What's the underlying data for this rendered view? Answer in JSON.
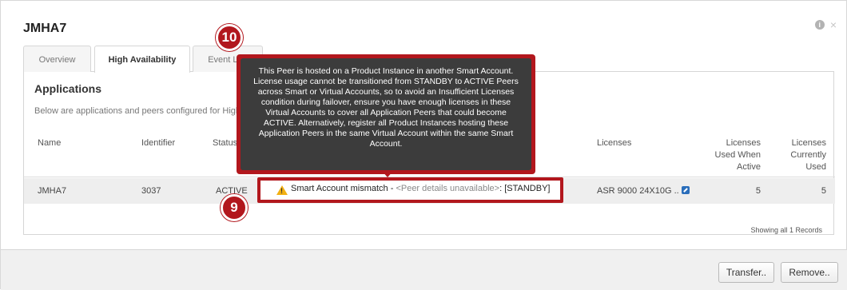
{
  "dialog": {
    "title": "JMHA7"
  },
  "tabs": [
    {
      "label": "Overview"
    },
    {
      "label": "High Availability"
    },
    {
      "label": "Event Log"
    }
  ],
  "section": {
    "title": "Applications",
    "description": "Below are applications and peers configured for High Availability"
  },
  "table": {
    "headers": {
      "name": "Name",
      "identifier": "Identifier",
      "status": "Status",
      "licenses": "Licenses",
      "used_when_active": [
        "Licenses",
        "Used When",
        "Active"
      ],
      "currently_used": [
        "Licenses",
        "Currently",
        "Used"
      ]
    },
    "row": {
      "name": "JMHA7",
      "identifier": "3037",
      "status": "ACTIVE",
      "peer_warning": "Smart Account mismatch - ",
      "peer_details": "<Peer details unavailable>",
      "peer_state": ": [STANDBY]",
      "licenses": "ASR 9000 24X10G ..",
      "used_when_active": "5",
      "currently_used": "5"
    },
    "records_note": "Showing all 1 Records"
  },
  "tooltip": {
    "text": "This Peer is hosted on a Product Instance in another Smart Account. License usage cannot be transitioned from STANDBY to ACTIVE Peers across Smart or Virtual Accounts, so to avoid an Insufficient Licenses condition during failover, ensure you have enough licenses in these Virtual Accounts to cover all Application Peers that could become ACTIVE. Alternatively, register all Product Instances hosting these Application Peers in the same Virtual Account within the same Smart Account."
  },
  "callouts": {
    "first": "10",
    "second": "9"
  },
  "buttons": {
    "transfer": "Transfer..",
    "remove": "Remove.."
  },
  "icons": {
    "info": "info-icon",
    "close": "close-icon",
    "warning": "warning-icon",
    "link": "external-link-icon"
  },
  "colors": {
    "callout": "#b2171d",
    "tooltip_bg": "#3c3c3c",
    "warning": "#f2b012",
    "link": "#2a6ebb"
  }
}
